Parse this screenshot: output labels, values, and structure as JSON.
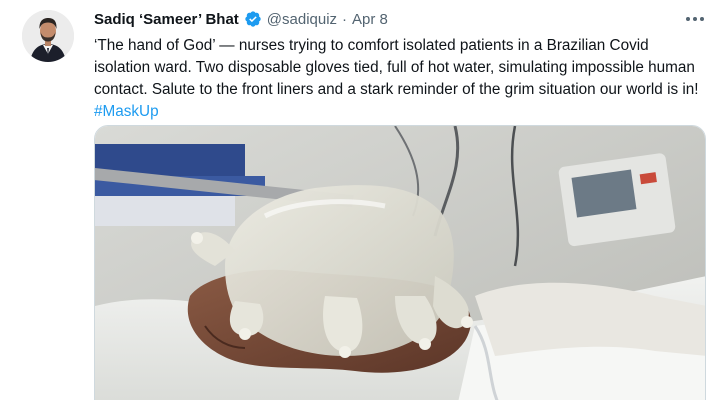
{
  "tweet": {
    "author": {
      "display_name": "Sadiq ‘Sameer’ Bhat",
      "handle": "@sadiquiz",
      "verified": true
    },
    "separator": "·",
    "date": "Apr 8",
    "text_before_hashtag": "‘The hand of God’ — nurses trying to comfort isolated patients in a Brazilian Covid isolation ward. Two disposable gloves tied, full of hot water, simulating impossible human contact. Salute to the front liners and a stark reminder of the grim situation our world is in! ",
    "hashtag": "#MaskUp",
    "icons": {
      "verified": "verified-badge-icon",
      "more": "more-options-icon"
    },
    "colors": {
      "link": "#1d9bf0",
      "secondary_text": "#536471",
      "primary_text": "#0f1419"
    }
  }
}
